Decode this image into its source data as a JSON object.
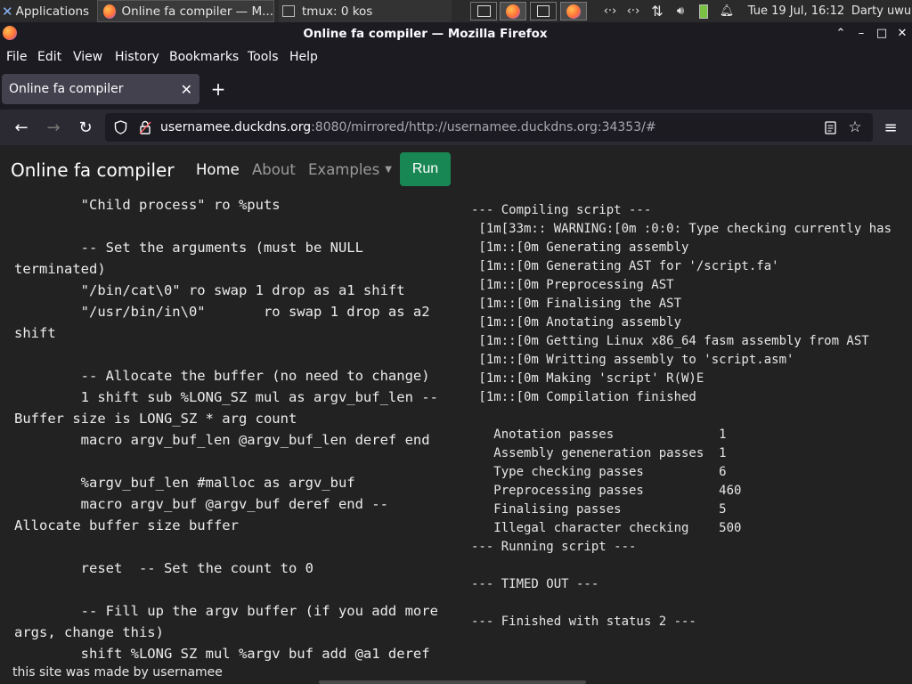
{
  "system_panel": {
    "apps_label": "Applications",
    "taskbar": [
      {
        "label": "Online fa compiler — M..."
      },
      {
        "label": "tmux: 0 kos"
      }
    ],
    "clock": "Tue 19 Jul, 16:12",
    "user": "Darty uwu"
  },
  "window": {
    "title": "Online fa compiler — Mozilla Firefox",
    "controls": {
      "minimize": "⌃",
      "restore": "–",
      "maximize": "□",
      "close": "✕"
    }
  },
  "menu": [
    "File",
    "Edit",
    "View",
    "History",
    "Bookmarks",
    "Tools",
    "Help"
  ],
  "tabs": [
    {
      "label": "Online fa compiler",
      "close": "✕"
    }
  ],
  "new_tab": "+",
  "urlbar": {
    "host": "usernamee.duckdns.org",
    "rest": ":8080/mirrored/http://usernamee.duckdns.org:34353/#"
  },
  "site": {
    "brand": "Online fa compiler",
    "nav": [
      {
        "label": "Home",
        "active": true
      },
      {
        "label": "About",
        "active": false
      },
      {
        "label": "Examples",
        "active": false
      }
    ],
    "run_label": "Run",
    "run_color": "#198754"
  },
  "code": "        \"Child process\" ro %puts\n\n        -- Set the arguments (must be NULL terminated)\n        \"/bin/cat\\0\" ro swap 1 drop as a1 shift\n        \"/usr/bin/in\\0\"       ro swap 1 drop as a2 shift\n\n        -- Allocate the buffer (no need to change)\n        1 shift sub %LONG_SZ mul as argv_buf_len -- Buffer size is LONG_SZ * arg count\n        macro argv_buf_len @argv_buf_len deref end\n\n        %argv_buf_len #malloc as argv_buf\n        macro argv_buf @argv_buf deref end -- Allocate buffer size buffer\n\n        reset  -- Set the count to 0\n\n        -- Fill up the argv buffer (if you add more args, change this)\n        shift %LONG_SZ mul %argv_buf add @a1 deref",
  "output": "--- Compiling script ---\n [1m[33m:: WARNING:[0m :0:0: Type checking currently has\n [1m::[0m Generating assembly\n [1m::[0m Generating AST for '/script.fa'\n [1m::[0m Preprocessing AST\n [1m::[0m Finalising the AST\n [1m::[0m Anotating assembly\n [1m::[0m Getting Linux x86_64 fasm assembly from AST\n [1m::[0m Writting assembly to 'script.asm'\n [1m::[0m Making 'script' R(W)E\n [1m::[0m Compilation finished\n\n   Anotation passes              1\n   Assembly geneneration passes  1\n   Type checking passes          6\n   Preprocessing passes          460\n   Finalising passes             5\n   Illegal character checking    500\n--- Running script ---\n\n--- TIMED OUT ---\n\n--- Finished with status 2 ---",
  "footer": "this site was made by usernamee"
}
